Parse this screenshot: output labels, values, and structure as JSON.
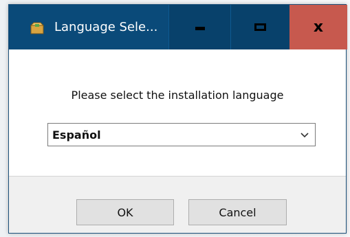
{
  "window": {
    "title": "Language Sele...",
    "app_icon": "installer-box-icon",
    "controls": {
      "minimize_icon": "minimize-icon",
      "maximize_icon": "maximize-icon",
      "close_label": "x"
    },
    "colors": {
      "titlebar": "#0a4a79",
      "close_button": "#c7594e"
    }
  },
  "dialog": {
    "prompt": "Please select the installation language",
    "language_select": {
      "selected": "Español",
      "icon": "chevron-down-icon"
    },
    "buttons": {
      "ok_label": "OK",
      "cancel_label": "Cancel"
    }
  }
}
